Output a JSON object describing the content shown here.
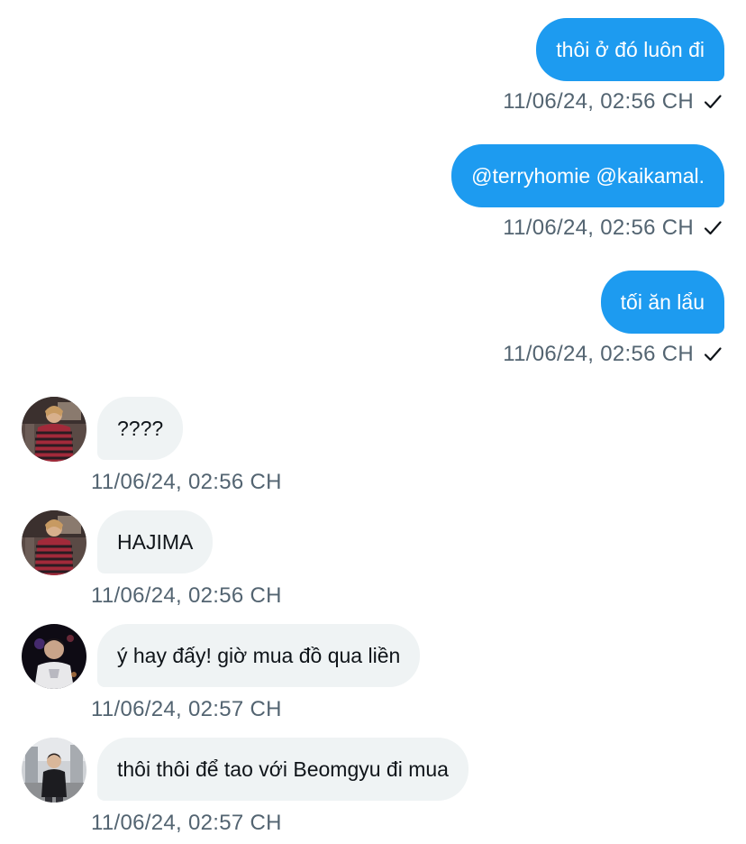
{
  "conversation": {
    "clipped_top_timestamp": "11/06/24, 02:56 CH",
    "messages": [
      {
        "direction": "outgoing",
        "text": "thôi ở đó luôn đi",
        "timestamp": "11/06/24, 02:56 CH",
        "status_icon": "check-icon"
      },
      {
        "direction": "outgoing",
        "text": "@terryhomie @kaikamal.",
        "timestamp": "11/06/24, 02:56 CH",
        "status_icon": "check-icon"
      },
      {
        "direction": "outgoing",
        "text": "tối ăn lẩu",
        "timestamp": "11/06/24, 02:56 CH",
        "status_icon": "check-icon"
      },
      {
        "direction": "incoming",
        "text": "????",
        "timestamp": "11/06/24, 02:56 CH",
        "avatar": "user-avatar-striped-sweater"
      },
      {
        "direction": "incoming",
        "text": "HAJIMA",
        "timestamp": "11/06/24, 02:56 CH",
        "avatar": "user-avatar-striped-sweater"
      },
      {
        "direction": "incoming",
        "text": "ý hay đấy! giờ mua đồ qua liền",
        "timestamp": "11/06/24, 02:57 CH",
        "avatar": "user-avatar-dark-portrait"
      },
      {
        "direction": "incoming",
        "text": "thôi thôi để tao với Beomgyu đi mua",
        "timestamp": "11/06/24, 02:57 CH",
        "avatar": "user-avatar-street-photo"
      }
    ]
  },
  "colors": {
    "outgoing_bubble": "#1d9bf0",
    "incoming_bubble": "#eff3f4",
    "timestamp_text": "#536471",
    "background": "#ffffff"
  }
}
